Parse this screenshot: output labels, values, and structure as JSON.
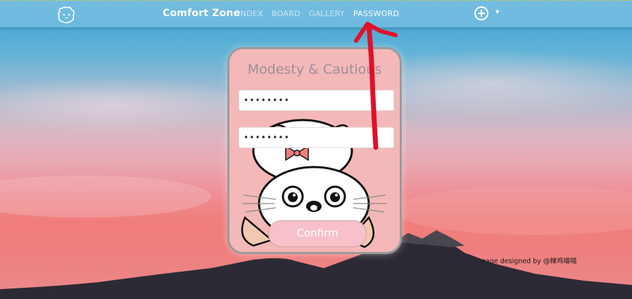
{
  "nav": {
    "brand": "Comfort Zone",
    "links": [
      "INDEX",
      "BOARD",
      "GALLERY",
      "PASSWORD"
    ],
    "active_link": "PASSWORD",
    "logo_icon": "hamster-face-icon",
    "add_icon": "plus-circle-icon"
  },
  "card": {
    "title": "Modesty & Cautious",
    "password1_value": "••••••••",
    "password2_value": "••••••••",
    "confirm_label": "Confirm"
  },
  "footer": {
    "credit": "page designed by @辣鸡喵喵"
  },
  "colors": {
    "card_bg": "#f4b8b8",
    "card_border": "#9a9a9a",
    "annotation": "#e0102a",
    "nav_bg": "#78bee1"
  }
}
